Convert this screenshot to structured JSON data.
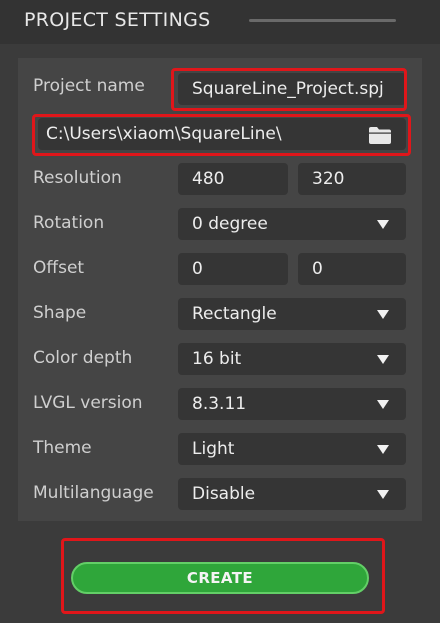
{
  "header": {
    "title": "PROJECT SETTINGS"
  },
  "project": {
    "name_label": "Project name",
    "name_value": "SquareLine_Project.spj",
    "path_value": "C:\\Users\\xiaom\\SquareLine\\"
  },
  "fields": {
    "resolution_label": "Resolution",
    "resolution_width": "480",
    "resolution_height": "320",
    "rotation_label": "Rotation",
    "rotation_value": "0 degree",
    "offset_label": "Offset",
    "offset_x": "0",
    "offset_y": "0",
    "shape_label": "Shape",
    "shape_value": "Rectangle",
    "color_depth_label": "Color depth",
    "color_depth_value": "16 bit",
    "lvgl_label": "LVGL version",
    "lvgl_value": "8.3.11",
    "theme_label": "Theme",
    "theme_value": "Light",
    "multilanguage_label": "Multilanguage",
    "multilanguage_value": "Disable"
  },
  "actions": {
    "create_label": "CREATE"
  },
  "colors": {
    "highlight": "#e0161a",
    "create_button": "#2fa63a"
  },
  "icons": {
    "folder": "folder-icon",
    "dropdown": "dropdown-arrow-icon"
  }
}
